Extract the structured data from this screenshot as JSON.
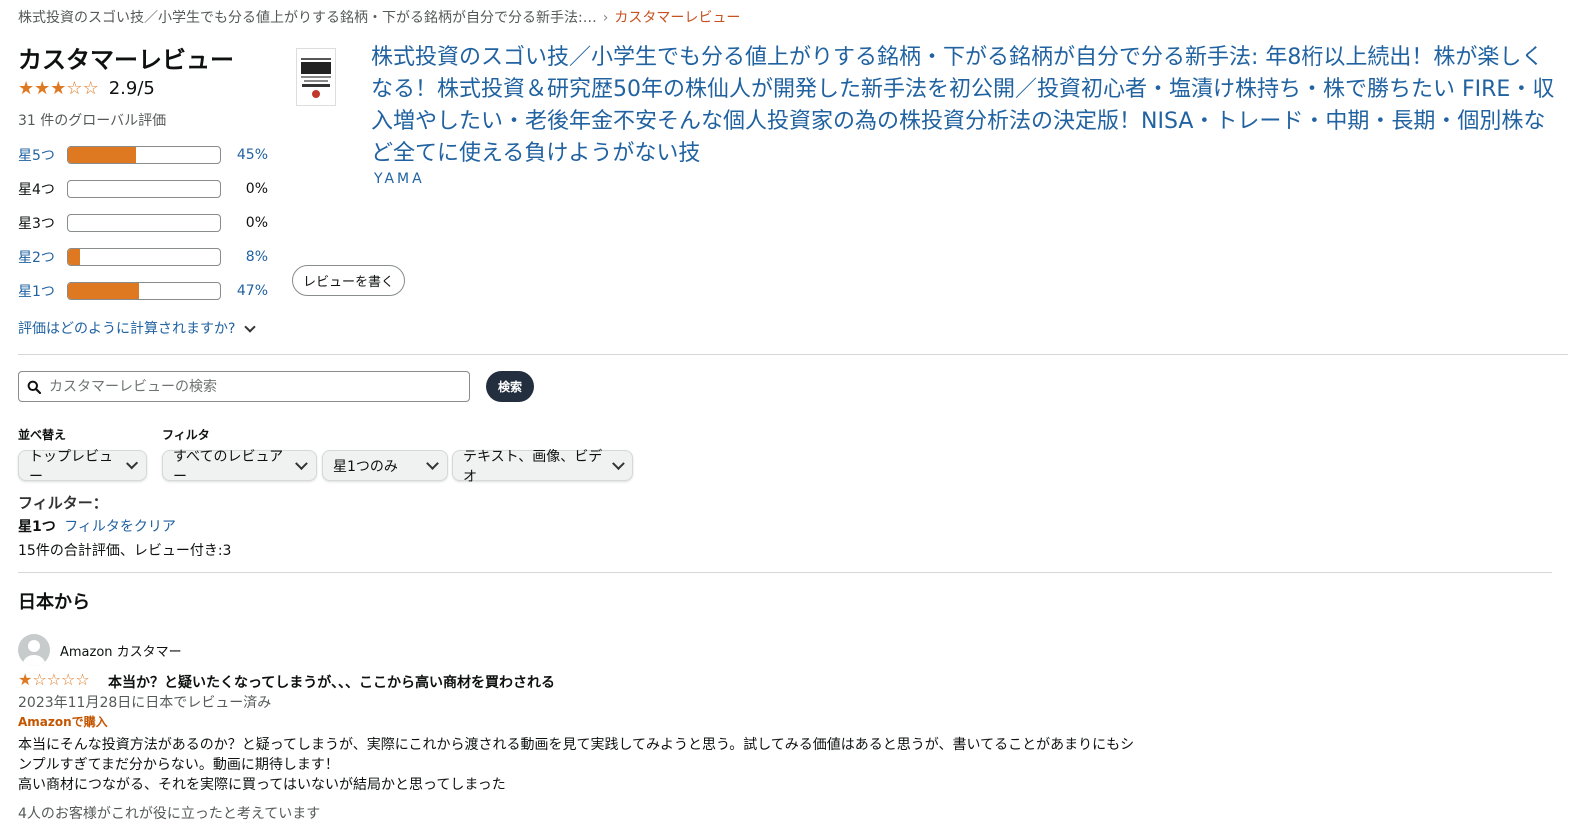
{
  "breadcrumb": {
    "product": "株式投資のスゴい技／小学生でも分る値上がりする銘柄・下がる銘柄が自分で分る新手法:…",
    "separator": "›",
    "current": "カスタマーレビュー"
  },
  "summary": {
    "heading": "カスタマーレビュー",
    "rating": 2.9,
    "rating_text": "2.9/5",
    "global_count": "31 件のグローバル評価",
    "histogram": [
      {
        "label": "星5つ",
        "percent": 45,
        "percent_text": "45%",
        "linked": true
      },
      {
        "label": "星4つ",
        "percent": 0,
        "percent_text": "0%",
        "linked": false
      },
      {
        "label": "星3つ",
        "percent": 0,
        "percent_text": "0%",
        "linked": false
      },
      {
        "label": "星2つ",
        "percent": 8,
        "percent_text": "8%",
        "linked": true
      },
      {
        "label": "星1つ",
        "percent": 47,
        "percent_text": "47%",
        "linked": true
      }
    ],
    "how_calculated": "評価はどのように計算されますか?"
  },
  "product": {
    "title": "株式投資のスゴい技／小学生でも分る値上がりする銘柄・下がる銘柄が自分で分る新手法: 年8桁以上続出！株が楽しくなる！株式投資＆研究歴50年の株仙人が開発した新手法を初公開／投資初心者・塩漬け株持ち・株で勝ちたい FIRE・収入増やしたい・老後年金不安そんな個人投資家の為の株投資分析法の決定版！NISA・トレード・中期・長期・個別株など全てに使える負けようがない技",
    "author": "YAMA",
    "write_review": "レビューを書く"
  },
  "search": {
    "placeholder": "カスタマーレビューの検索",
    "button": "検索"
  },
  "sort": {
    "label": "並べ替え",
    "value": "トップレビュー"
  },
  "filter": {
    "label": "フィルタ",
    "reviewers": "すべてのレビュアー",
    "stars": "星1つのみ",
    "media": "テキスト、画像、ビデオ"
  },
  "active_filter": {
    "heading": "フィルター：",
    "value": "星1つ",
    "clear": "フィルタをクリア",
    "total": "15件の合計評価、レビュー付き:3"
  },
  "section": {
    "title": "日本から"
  },
  "review": {
    "reviewer": "Amazon カスタマー",
    "rating": 1,
    "title": "本当か？と疑いたくなってしまうが、、、ここから高い商材を買わされる",
    "date": "2023年11月28日に日本でレビュー済み",
    "verified": "Amazonで購入",
    "body_line1": "本当にそんな投資方法があるのか？と疑ってしまうが、実際にこれから渡される動画を見て実践してみようと思う。試してみる価値はあると思うが、書いてることがあまりにもシンプルすぎてまだ分からない。動画に期待します！",
    "body_line2": "高い商材につながる、それを実際に買ってはいないが結局かと思ってしまった",
    "helpful": "4人のお客様がこれが役に立ったと考えています"
  },
  "colors": {
    "link": "#2162a1",
    "star": "#de7921",
    "verified": "#c45500",
    "search_button": "#232f3e"
  },
  "icons": {
    "search": "search-icon",
    "chevron": "chevron-down-icon",
    "avatar": "avatar-icon"
  }
}
